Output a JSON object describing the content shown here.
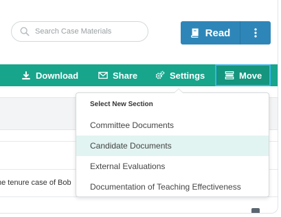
{
  "search": {
    "placeholder": "Search Case Materials",
    "icon": "search-icon"
  },
  "read_button": {
    "label": "Read",
    "icon": "book-icon",
    "color": "#2e86b8"
  },
  "more_button": {
    "icon": "vertical-ellipsis-icon"
  },
  "toolbar": {
    "color": "#17a58c",
    "download_label": "Download",
    "share_label": "Share",
    "settings_label": "Settings",
    "move_label": "Move"
  },
  "row": {
    "text": "he tenure case of Bob"
  },
  "dropdown": {
    "header": "Select New Section",
    "items": [
      {
        "label": "Committee Documents"
      },
      {
        "label": "Candidate Documents",
        "highlighted": true
      },
      {
        "label": "External Evaluations"
      },
      {
        "label": "Documentation of Teaching Effectiveness"
      }
    ]
  }
}
